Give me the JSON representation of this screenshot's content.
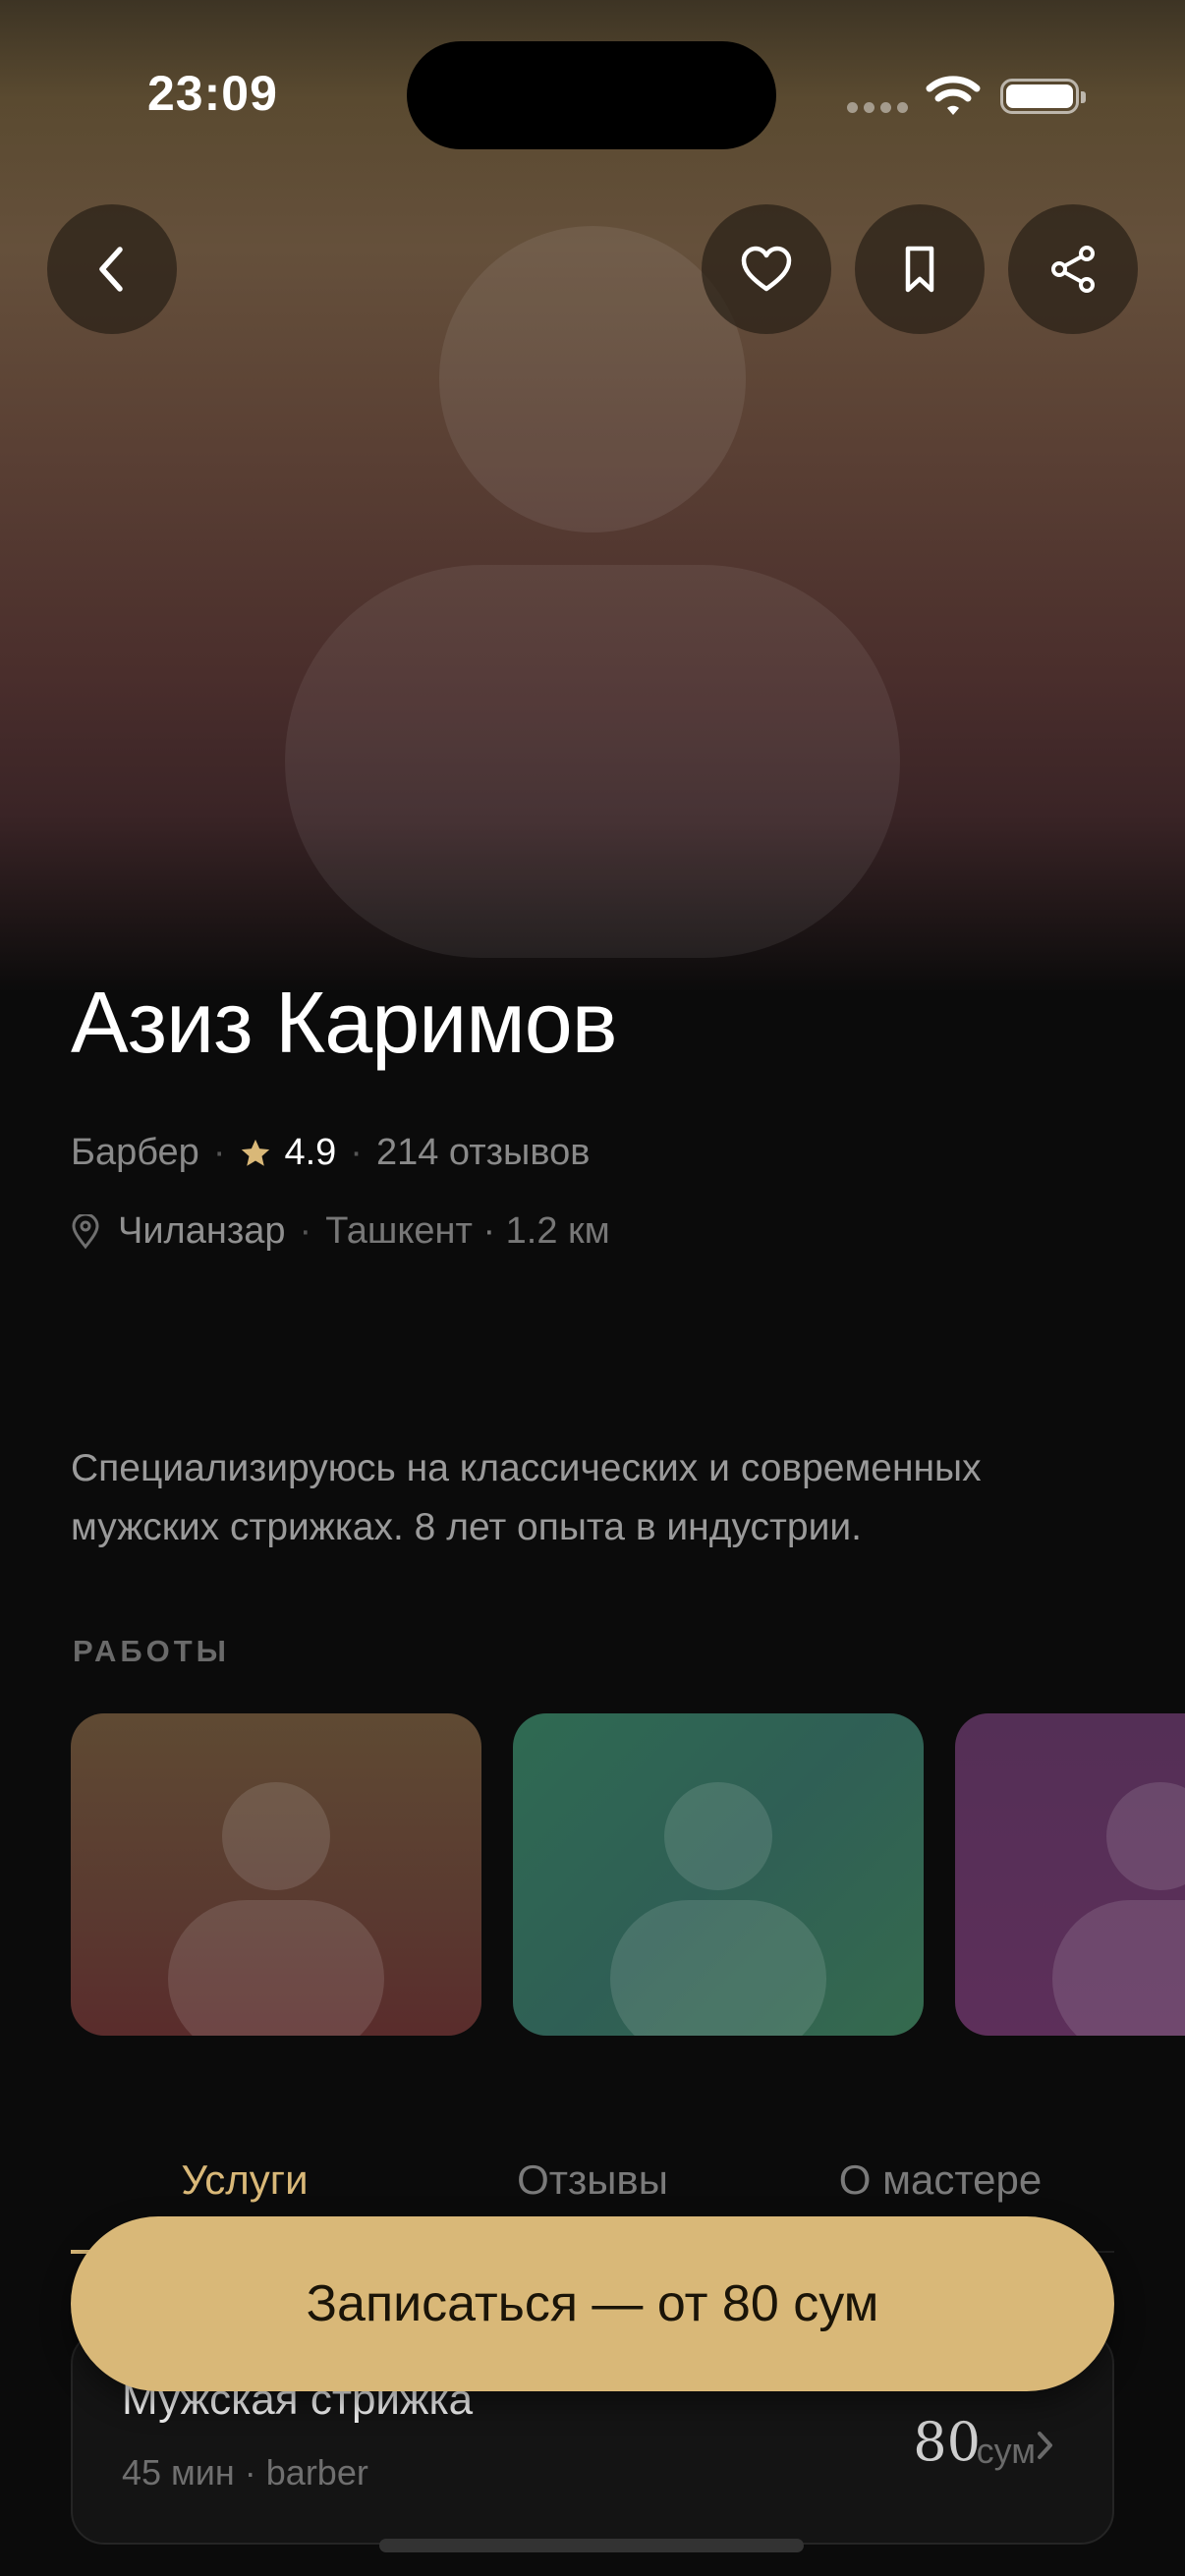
{
  "status_bar": {
    "time": "23:09"
  },
  "header": {
    "back_icon": "chevron-left-icon",
    "actions": [
      "heart-icon",
      "bookmark-icon",
      "share-icon"
    ]
  },
  "profile": {
    "name": "Азиз Каримов",
    "role": "Барбер",
    "rating": "4.9",
    "reviews": "214 отзывов",
    "district": "Чиланзар",
    "city_distance": "Ташкент · 1.2 км",
    "about": "Специализируюсь на классических и современных мужских стрижках. 8 лет опыта в индустрии."
  },
  "works": {
    "label": "РАБОТЫ",
    "colors": [
      "#5f4a33",
      "#2f6a52",
      "#5d2f5a"
    ]
  },
  "tabs": [
    {
      "label": "Услуги",
      "active": true
    },
    {
      "label": "Отзывы",
      "active": false
    },
    {
      "label": "О мастере",
      "active": false
    }
  ],
  "services": [
    {
      "title": "Мужская стрижка",
      "subtitle": "45 мин · barber",
      "price": "80",
      "currency": "сум"
    }
  ],
  "cta": {
    "label": "Записаться — от 80 сум"
  },
  "colors": {
    "accent": "#d9b878",
    "background": "#0b0b0b"
  }
}
